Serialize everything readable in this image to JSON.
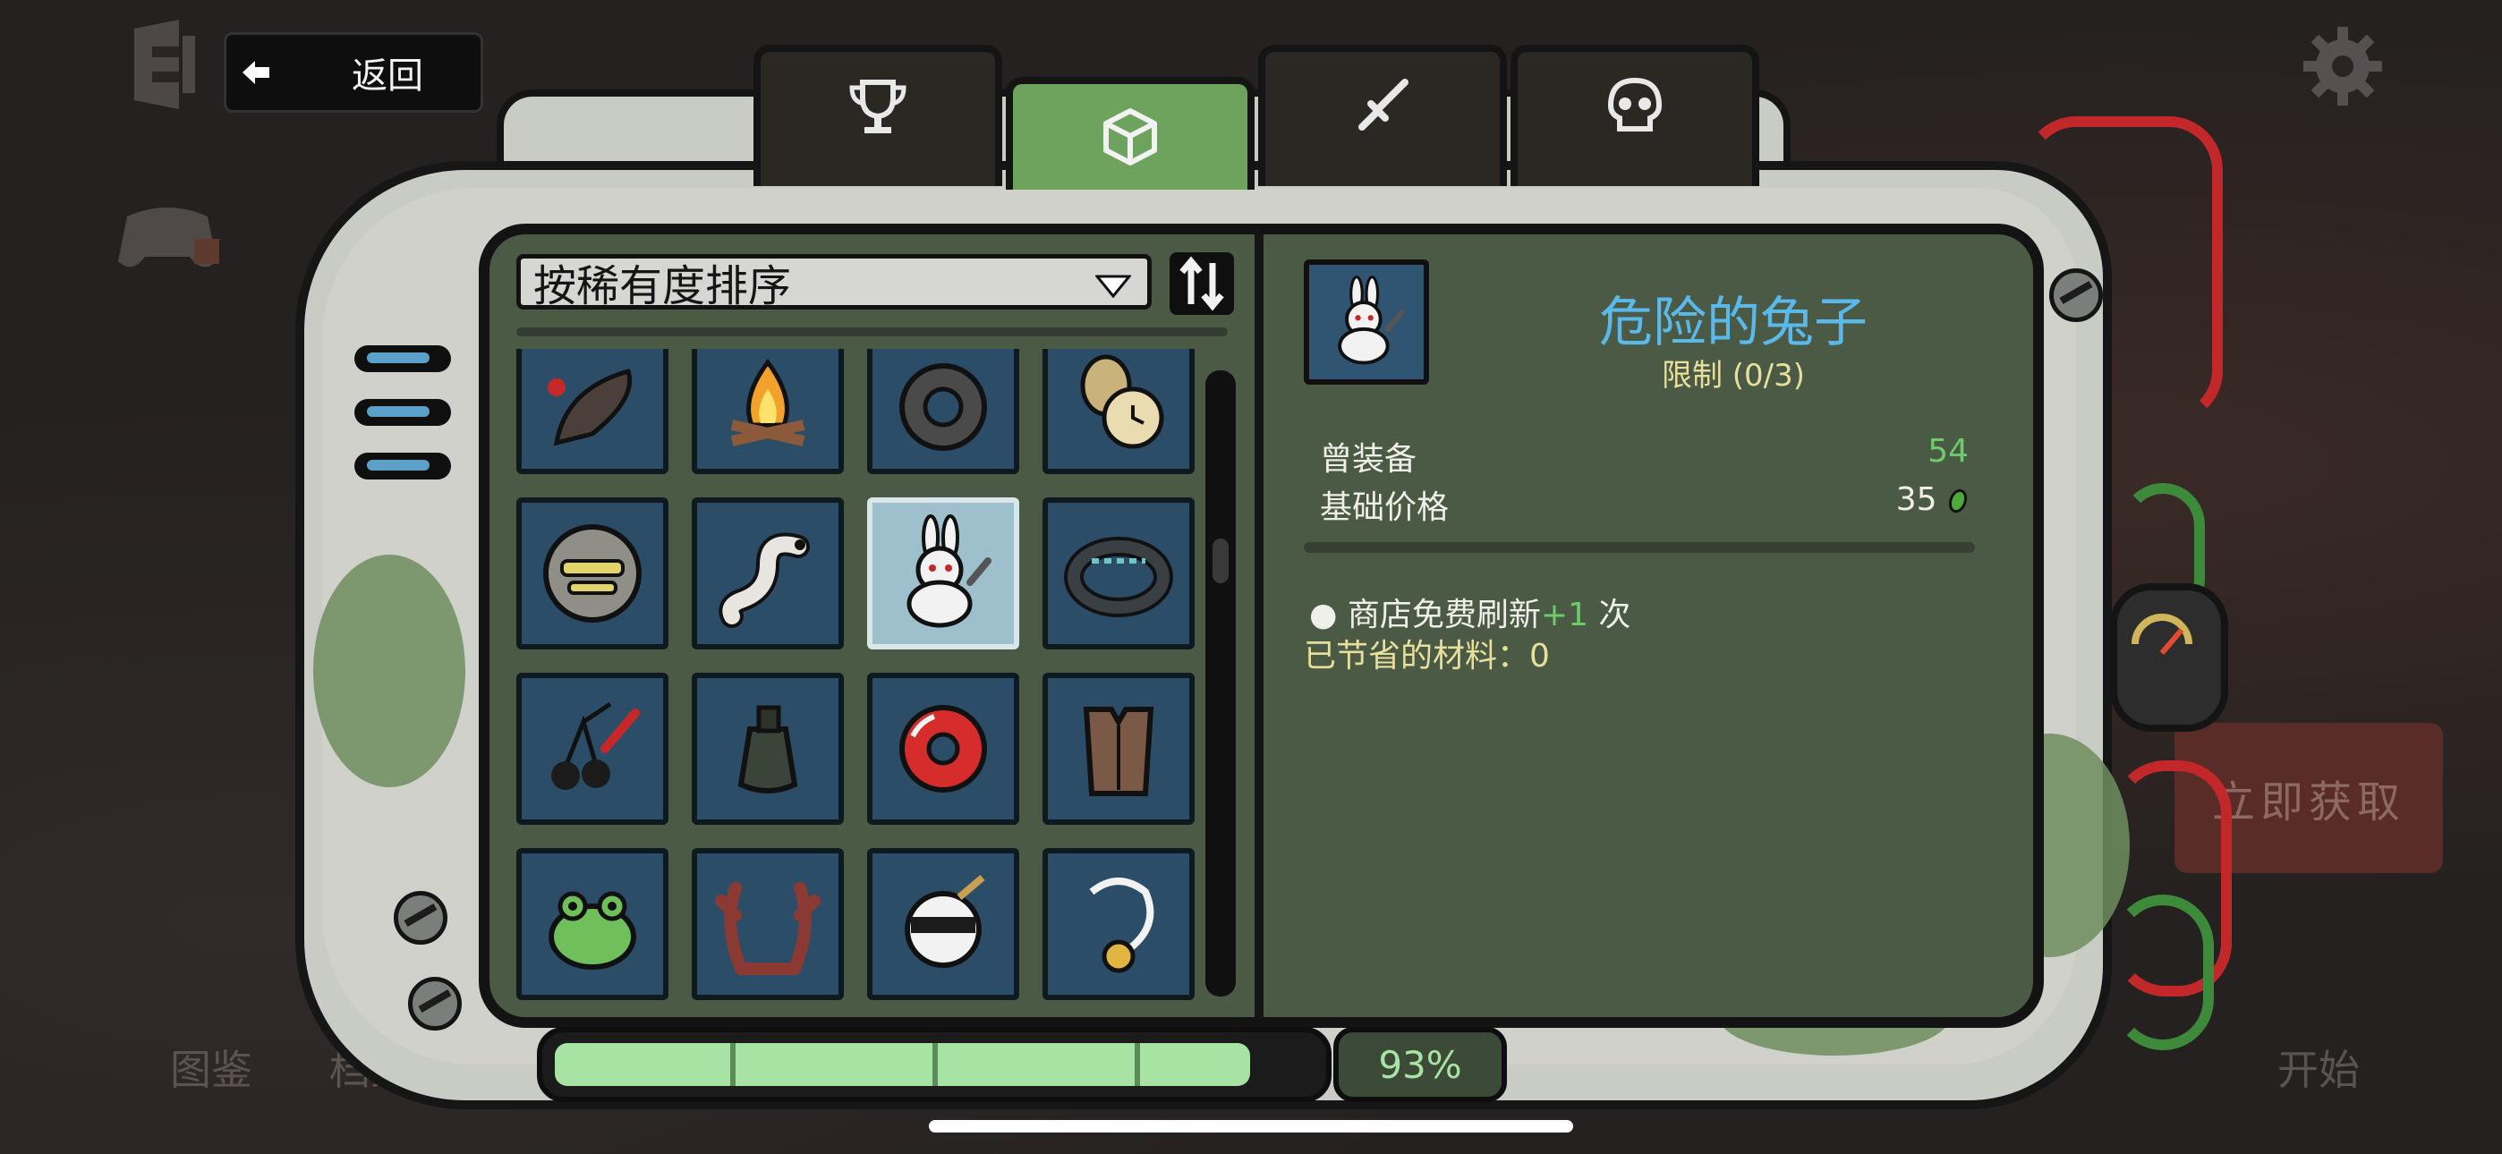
{
  "top_bar": {
    "back_label": "返回"
  },
  "background": {
    "left_labels": [
      "图鉴",
      "档案"
    ],
    "start_label": "开始",
    "get_now_label": "立即获取"
  },
  "tabs": [
    {
      "icon": "trophy-icon",
      "active": false
    },
    {
      "icon": "cube-icon",
      "active": true
    },
    {
      "icon": "sword-icon",
      "active": false
    },
    {
      "icon": "skull-icon",
      "active": false
    }
  ],
  "sort": {
    "selected": "按稀有度排序"
  },
  "items": [
    "severed-tail-icon",
    "campfire-icon",
    "gear-ring-icon",
    "pocket-watch-icon",
    "knight-helmet-icon",
    "worm-icon",
    "dangerous-bunny-icon",
    "dark-ring-icon",
    "bloody-cherries-icon",
    "grenade-pouch-icon",
    "red-donut-icon",
    "leather-vest-icon",
    "frog-icon",
    "antlers-icon",
    "ninja-ball-icon",
    "gold-pendant-icon"
  ],
  "selected_item_index": 6,
  "detail": {
    "name": "危险的兔子",
    "limit": "限制 (0/3)",
    "stats": [
      {
        "label": "曾装备",
        "value": "54"
      },
      {
        "label": "基础价格",
        "value": "35"
      }
    ],
    "effect_prefix": "● 商店免费刷新",
    "effect_plus": "+1",
    "effect_suffix": " 次",
    "saved_materials": "已节省的材料：0"
  },
  "progress": {
    "percent_label": "93%",
    "fraction": 0.93
  },
  "colors": {
    "accent_green": "#6ea35e",
    "title_blue": "#5ab8ea",
    "stat_green": "#6dcc6a",
    "cream": "#e7df9c"
  }
}
